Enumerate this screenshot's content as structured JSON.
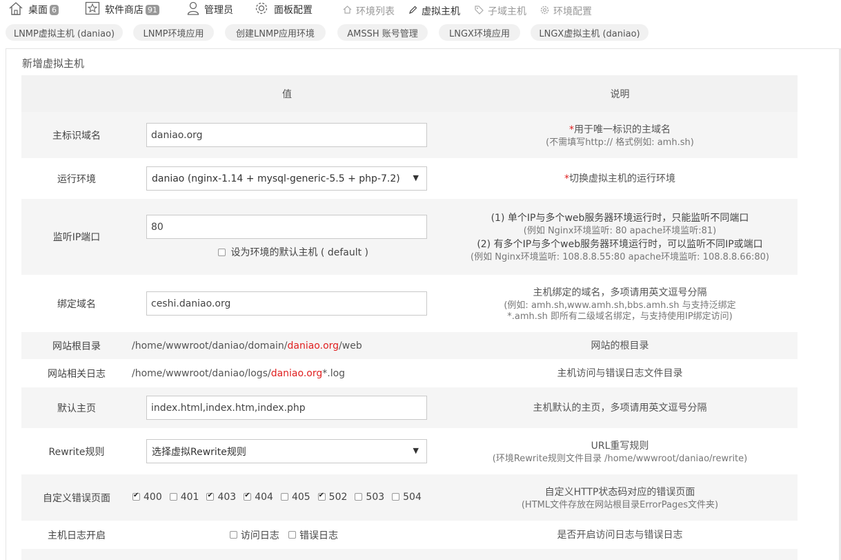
{
  "nav": {
    "items": [
      {
        "label": "桌面",
        "badge": "6",
        "icon": "home-icon"
      },
      {
        "label": "软件商店",
        "badge": "91",
        "icon": "store-icon"
      },
      {
        "label": "管理员",
        "icon": "user-icon"
      },
      {
        "label": "面板配置",
        "icon": "gear-icon"
      }
    ],
    "sub": [
      {
        "label": "环境列表",
        "icon": "home-icon"
      },
      {
        "label": "虚拟主机",
        "icon": "pencil-icon"
      },
      {
        "label": "子域主机",
        "icon": "tag-icon"
      },
      {
        "label": "环境配置",
        "icon": "gear-icon"
      }
    ]
  },
  "subtabs": [
    "LNMP虚拟主机 (daniao)",
    "LNMP环境应用",
    "创建LNMP应用环境",
    "AMSSH 账号管理",
    "LNGX环境应用",
    "LNGX虚拟主机 (daniao)"
  ],
  "panel": {
    "title": "新增虚拟主机",
    "head_value": "值",
    "head_desc": "说明"
  },
  "form": {
    "domain": {
      "label": "主标识域名",
      "value": "daniao.org",
      "req": "*",
      "desc": "用于唯一标识的主域名",
      "desc2": "(不需填写http:// 格式例如: amh.sh)"
    },
    "env": {
      "label": "运行环境",
      "value": "daniao (nginx-1.14 + mysql-generic-5.5 + php-7.2)",
      "req": "*",
      "desc": "切换虚拟主机的运行环境"
    },
    "port": {
      "label": "监听IP端口",
      "value": "80",
      "default_label": "设为环境的默认主机 ( default )",
      "d1": "(1) 单个IP与多个web服务器环境运行时，只能监听不同端口",
      "d2": "(例如 Nginx环境监听: 80   apache环境监听:81)",
      "d3": "(2) 有多个IP与多个web服务器环境运行时，可以监听不同IP或端口",
      "d4": "(例如 Nginx环境监听: 108.8.8.55:80   apache环境监听: 108.8.8.66:80)"
    },
    "bind": {
      "label": "绑定域名",
      "value": "ceshi.daniao.org",
      "d1": "主机绑定的域名，多项请用英文逗号分隔",
      "d2": "(例如: amh.sh,www.amh.sh,bbs.amh.sh 与支持泛绑定",
      "d3": "*.amh.sh 即所有二级域名绑定，与支持使用IP绑定访问)"
    },
    "root": {
      "label": "网站根目录",
      "pre": "/home/wwwroot/daniao/domain/",
      "hl": "daniao.org",
      "post": "/web",
      "desc": "网站的根目录"
    },
    "log": {
      "label": "网站相关日志",
      "pre": "/home/wwwroot/daniao/logs/",
      "hl": "daniao.org",
      "post": "*.log",
      "desc": "主机访问与错误日志文件目录"
    },
    "index": {
      "label": "默认主页",
      "value": "index.html,index.htm,index.php",
      "desc": "主机默认的主页，多项请用英文逗号分隔"
    },
    "rewrite": {
      "label": "Rewrite规则",
      "value": "选择虚拟Rewrite规则",
      "d1": "URL重写规则",
      "d2": "(环境Rewrite规则文件目录 /home/wwwroot/daniao/rewrite)"
    },
    "errpages": {
      "label": "自定义错误页面",
      "codes": [
        {
          "code": "400",
          "checked": true
        },
        {
          "code": "401",
          "checked": false
        },
        {
          "code": "403",
          "checked": true
        },
        {
          "code": "404",
          "checked": true
        },
        {
          "code": "405",
          "checked": false
        },
        {
          "code": "502",
          "checked": true
        },
        {
          "code": "503",
          "checked": false
        },
        {
          "code": "504",
          "checked": false
        }
      ],
      "d1": "自定义HTTP状态码对应的错误页面",
      "d2": "(HTML文件存放在网站根目录ErrorPages文件夹)"
    },
    "logs": {
      "label": "主机日志开启",
      "access": "访问日志",
      "error": "错误日志",
      "desc": "是否开启访问日志与错误日志"
    }
  }
}
